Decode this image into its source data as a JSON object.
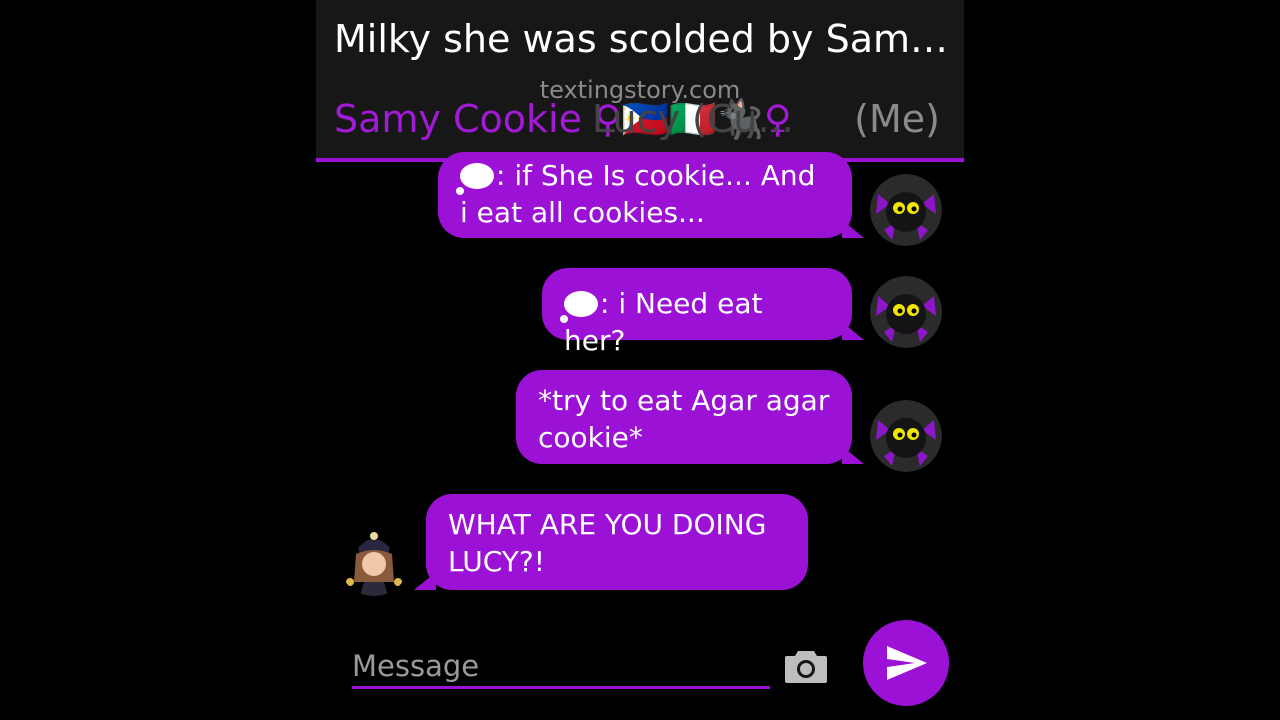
{
  "header": {
    "title": "Milky she was scolded by Sam…",
    "watermark": "textingstory.com",
    "contact_name": "Samy Cookie ♀🇵🇭🇮🇹🐈‍⬛♀",
    "contact_overlay": "Lucy (Cu...",
    "me_label": "(Me)"
  },
  "messages": [
    {
      "side": "right",
      "lines": [
        "💭: if She Is cookie... And",
        "i eat all cookies..."
      ],
      "avatar": "black-cat-avatar"
    },
    {
      "side": "right",
      "lines": [
        "💭: i Need eat her?"
      ],
      "avatar": "black-cat-avatar"
    },
    {
      "side": "right",
      "lines": [
        "*try to eat Agar agar",
        "cookie*"
      ],
      "avatar": "black-cat-avatar"
    },
    {
      "side": "left",
      "lines": [
        "WHAT ARE YOU DOING",
        "LUCY?!"
      ],
      "avatar": "cookie-character-avatar"
    }
  ],
  "composer": {
    "placeholder": "Message",
    "camera_icon": "camera-icon",
    "send_icon": "send-icon"
  },
  "colors": {
    "accent": "#9b12d6",
    "contact_name": "#a21ad8",
    "header_bg": "#171717",
    "background": "#000000"
  }
}
